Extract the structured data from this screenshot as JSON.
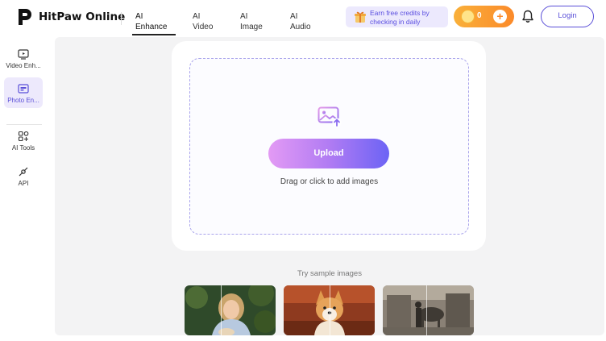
{
  "header": {
    "brand": "HitPaw Online",
    "nav": [
      {
        "line1": "AI",
        "line2": "Enhance"
      },
      {
        "line1": "AI",
        "line2": "Video"
      },
      {
        "line1": "AI",
        "line2": "Image"
      },
      {
        "line1": "AI",
        "line2": "Audio"
      }
    ],
    "promo": {
      "line1": "Earn free credits by",
      "line2": "checking in daily"
    },
    "credits": "0",
    "login_label": "Login"
  },
  "sidebar": {
    "items": [
      {
        "label": "Video Enh...",
        "icon": "video-enhance-icon"
      },
      {
        "label": "Photo En...",
        "icon": "photo-enhance-icon"
      },
      {
        "label": "AI Tools",
        "icon": "ai-tools-icon"
      },
      {
        "label": "API",
        "icon": "api-icon"
      }
    ]
  },
  "main": {
    "upload_label": "Upload",
    "drop_hint": "Drag or click to add images",
    "sample_title": "Try sample images"
  },
  "colors": {
    "accent": "#5a4fd8",
    "credit_gradient_start": "#f9b03a",
    "credit_gradient_end": "#fb8a2a",
    "upload_gradient_start": "#e39af4",
    "upload_gradient_end": "#6c63f5"
  }
}
